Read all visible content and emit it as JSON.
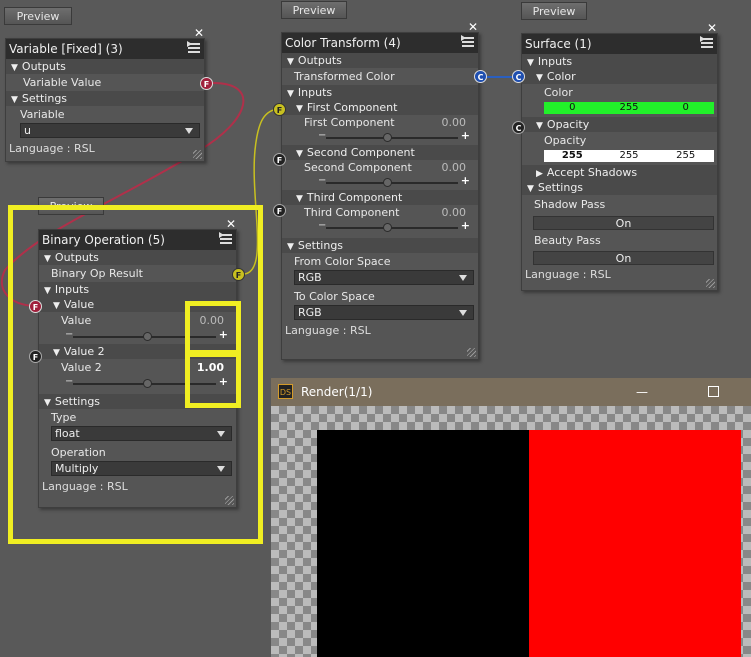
{
  "preview_label": "Preview",
  "variable_node": {
    "title": "Variable [Fixed] (3)",
    "outputs_label": "Outputs",
    "output_variable_value": "Variable Value",
    "settings_label": "Settings",
    "variable_label": "Variable",
    "variable_value": "u",
    "language": "Language : RSL",
    "port_f": "F"
  },
  "color_transform_node": {
    "title": "Color Transform (4)",
    "outputs_label": "Outputs",
    "output_transformed_color": "Transformed Color",
    "inputs_label": "Inputs",
    "first_component_label": "First Component",
    "first_component_value": "0.00",
    "second_component_label": "Second Component",
    "second_component_value": "0.00",
    "third_component_label": "Third Component",
    "third_component_value": "0.00",
    "settings_label": "Settings",
    "from_color_space_label": "From Color Space",
    "from_color_space_value": "RGB",
    "to_color_space_label": "To Color Space",
    "to_color_space_value": "RGB",
    "language": "Language : RSL",
    "port_f": "F",
    "port_c": "C"
  },
  "surface_node": {
    "title": "Surface (1)",
    "inputs_label": "Inputs",
    "color_label": "Color",
    "color_param_label": "Color",
    "color_values": [
      "0",
      "255",
      "0"
    ],
    "color_hex": "#22f02a",
    "opacity_label": "Opacity",
    "opacity_param_label": "Opacity",
    "opacity_values": [
      "255",
      "255",
      "255"
    ],
    "accept_shadows_label": "Accept Shadows",
    "settings_label": "Settings",
    "shadow_pass_label": "Shadow Pass",
    "shadow_pass_value": "On",
    "beauty_pass_label": "Beauty Pass",
    "beauty_pass_value": "On",
    "language": "Language : RSL",
    "port_c": "C"
  },
  "binary_op_node": {
    "title": "Binary Operation (5)",
    "outputs_label": "Outputs",
    "output_result": "Binary Op Result",
    "inputs_label": "Inputs",
    "value_section_label": "Value",
    "value_label": "Value",
    "value_value": "0.00",
    "value2_section_label": "Value 2",
    "value2_label": "Value 2",
    "value2_value": "1.00",
    "settings_label": "Settings",
    "type_label": "Type",
    "type_value": "float",
    "operation_label": "Operation",
    "operation_value": "Multiply",
    "language": "Language : RSL",
    "port_f": "F"
  },
  "render_window": {
    "title": "Render(1/1)",
    "logo_text": "DS",
    "minimize_glyph": "—",
    "close_glyph": "✕",
    "left_color": "#000000",
    "right_color": "#ff0000"
  },
  "colors": {
    "highlight": "#f0ee22",
    "wire_red": "#b0304a",
    "wire_yellow": "#c8c020",
    "wire_blue": "#2a5fc0"
  }
}
